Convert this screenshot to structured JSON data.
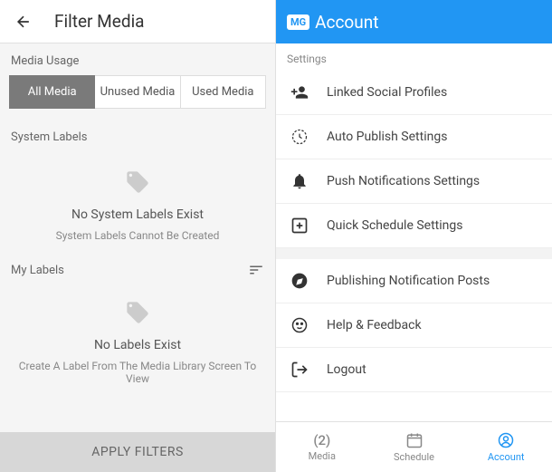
{
  "left": {
    "title": "Filter Media",
    "mediaUsageLabel": "Media Usage",
    "tabs": [
      "All Media",
      "Unused Media",
      "Used Media"
    ],
    "systemLabels": {
      "heading": "System Labels",
      "emptyTitle": "No System Labels Exist",
      "emptySub": "System Labels Cannot Be Created"
    },
    "myLabels": {
      "heading": "My Labels",
      "emptyTitle": "No Labels Exist",
      "emptySub": "Create A Label From The Media Library Screen To View"
    },
    "applyButton": "APPLY FILTERS"
  },
  "right": {
    "badge": "MG",
    "title": "Account",
    "settingsLabel": "Settings",
    "menu": [
      {
        "label": "Linked Social Profiles"
      },
      {
        "label": "Auto Publish Settings"
      },
      {
        "label": "Push Notifications Settings"
      },
      {
        "label": "Quick Schedule Settings"
      },
      {
        "label": "Publishing Notification Posts"
      },
      {
        "label": "Help & Feedback"
      },
      {
        "label": "Logout"
      }
    ],
    "nav": {
      "media": "Media",
      "mediaCount": "(2)",
      "schedule": "Schedule",
      "account": "Account"
    }
  }
}
